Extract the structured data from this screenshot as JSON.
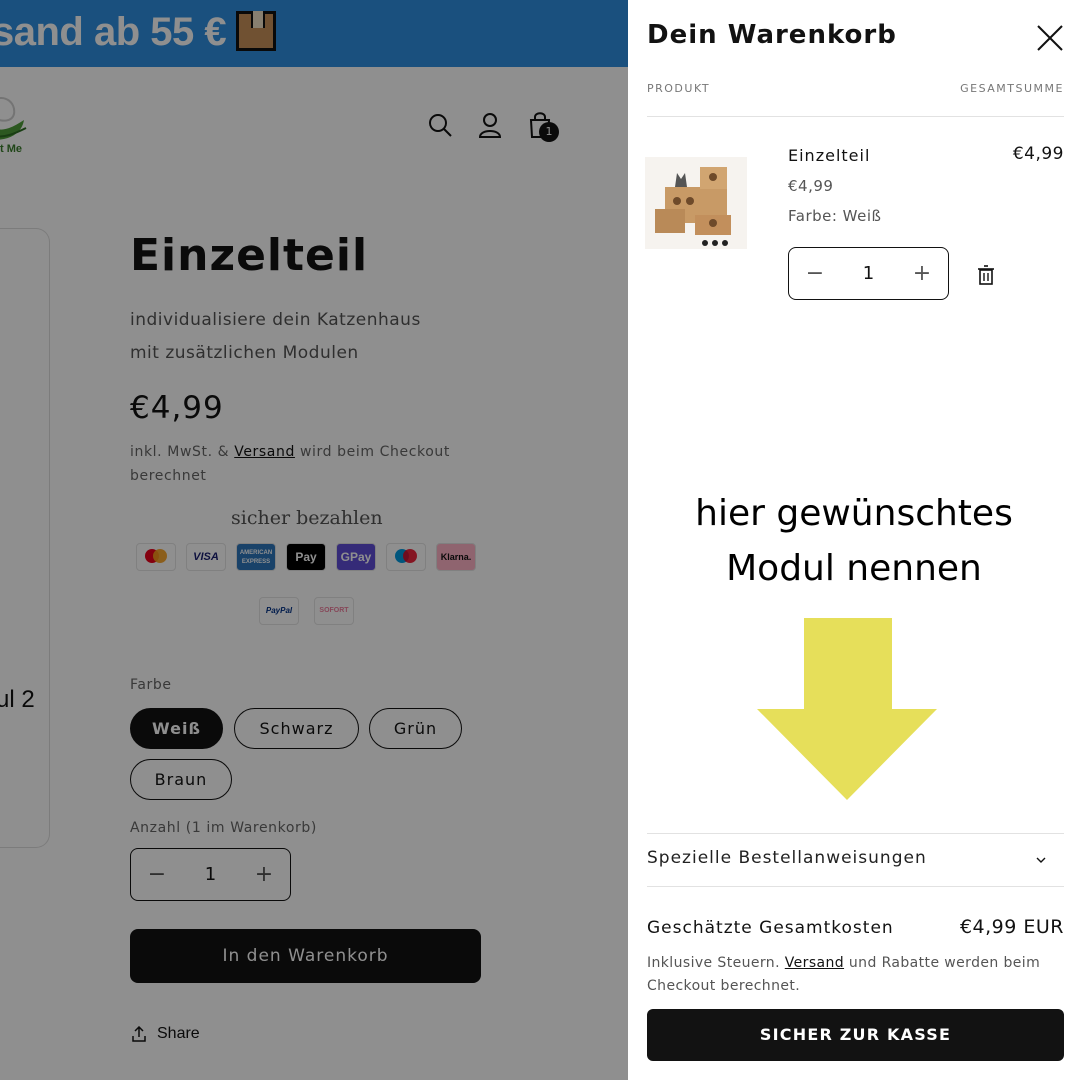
{
  "banner": {
    "text": "sand ab 55 €",
    "icon": "package-box-icon",
    "color": "#2f8fe0"
  },
  "store": {
    "logo_text": "t Me",
    "cart_count": "1"
  },
  "header_icons": [
    "search-icon",
    "account-icon",
    "cart-icon"
  ],
  "gallery": {
    "caption": "ul 2"
  },
  "product": {
    "title": "Einzelteil",
    "description_line1": "individualisiere dein Katzenhaus",
    "description_line2": "mit zusätzlichen Modulen",
    "price": "€4,99",
    "tax_prefix": "inkl. MwSt. & ",
    "tax_link": "Versand",
    "tax_suffix": " wird beim Checkout berechnet",
    "secure_payment_label": "sicher bezahlen",
    "payment_methods": [
      "Mastercard",
      "VISA",
      "American Express",
      "Apple Pay",
      "G Pay",
      "Maestro",
      "Klarna",
      "PayPal",
      "SOFORT"
    ],
    "color_label": "Farbe",
    "colors": [
      "Weiß",
      "Schwarz",
      "Grün",
      "Braun"
    ],
    "selected_color": "Weiß",
    "quantity_label": "Anzahl (1 im Warenkorb)",
    "quantity": "1",
    "add_to_cart": "In den Warenkorb",
    "share": "Share"
  },
  "cart": {
    "title": "Dein Warenkorb",
    "col_product": "PRODUKT",
    "col_total": "GESAMTSUMME",
    "item": {
      "name": "Einzelteil",
      "price": "€4,99",
      "variant": "Farbe: Weiß",
      "quantity": "1",
      "total": "€4,99"
    },
    "annotation_line1": "hier gewünschtes",
    "annotation_line2": "Modul nennen",
    "arrow_color": "#e6df5a",
    "instructions": "Spezielle Bestellanweisungen",
    "estimated_label": "Geschätzte Gesamtkosten",
    "estimated_value": "€4,99 EUR",
    "note_prefix": "Inklusive Steuern. ",
    "note_link": "Versand",
    "note_suffix": " und Rabatte werden beim Checkout berechnet.",
    "checkout": "SICHER ZUR KASSE"
  }
}
